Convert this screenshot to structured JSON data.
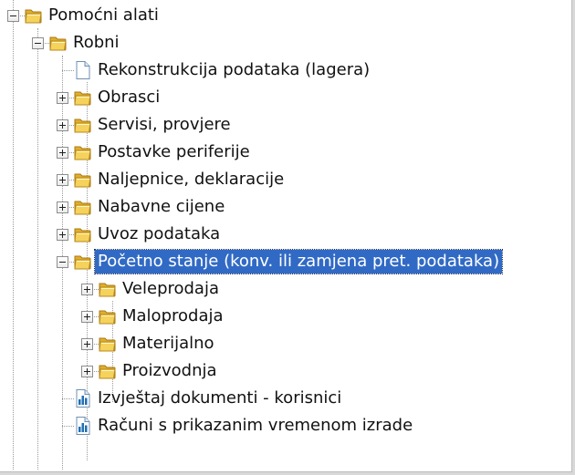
{
  "tree": {
    "items": [
      {
        "label": "Pomoćni alati",
        "level": 0,
        "icon": "folder",
        "toggle": "minus",
        "selected": false
      },
      {
        "label": "Robni",
        "level": 1,
        "icon": "folder",
        "toggle": "minus",
        "selected": false
      },
      {
        "label": "Rekonstrukcija podataka (lagera)",
        "level": 2,
        "icon": "document",
        "toggle": "",
        "selected": false
      },
      {
        "label": "Obrasci",
        "level": 2,
        "icon": "folder",
        "toggle": "plus",
        "selected": false
      },
      {
        "label": "Servisi, provjere",
        "level": 2,
        "icon": "folder",
        "toggle": "plus",
        "selected": false
      },
      {
        "label": "Postavke periferije",
        "level": 2,
        "icon": "folder",
        "toggle": "plus",
        "selected": false
      },
      {
        "label": "Naljepnice, deklaracije",
        "level": 2,
        "icon": "folder",
        "toggle": "plus",
        "selected": false
      },
      {
        "label": "Nabavne cijene",
        "level": 2,
        "icon": "folder",
        "toggle": "plus",
        "selected": false
      },
      {
        "label": "Uvoz podataka",
        "level": 2,
        "icon": "folder",
        "toggle": "plus",
        "selected": false
      },
      {
        "label": "Početno stanje (konv. ili zamjena pret. podataka)",
        "level": 2,
        "icon": "folder",
        "toggle": "minus",
        "selected": true
      },
      {
        "label": "Veleprodaja",
        "level": 3,
        "icon": "folder",
        "toggle": "plus",
        "selected": false
      },
      {
        "label": "Maloprodaja",
        "level": 3,
        "icon": "folder",
        "toggle": "plus",
        "selected": false
      },
      {
        "label": "Materijalno",
        "level": 3,
        "icon": "folder",
        "toggle": "plus",
        "selected": false
      },
      {
        "label": "Proizvodnja",
        "level": 3,
        "icon": "folder",
        "toggle": "plus",
        "selected": false
      },
      {
        "label": "Izvještaj dokumenti - korisnici",
        "level": 2,
        "icon": "report",
        "toggle": "",
        "selected": false
      },
      {
        "label": "Računi s prikazanim vremenom izrade",
        "level": 2,
        "icon": "report",
        "toggle": "",
        "selected": false
      }
    ]
  },
  "colors": {
    "selection": "#316ac5",
    "folder": "#f5d25c",
    "report_bars": "#1f6fb3"
  }
}
